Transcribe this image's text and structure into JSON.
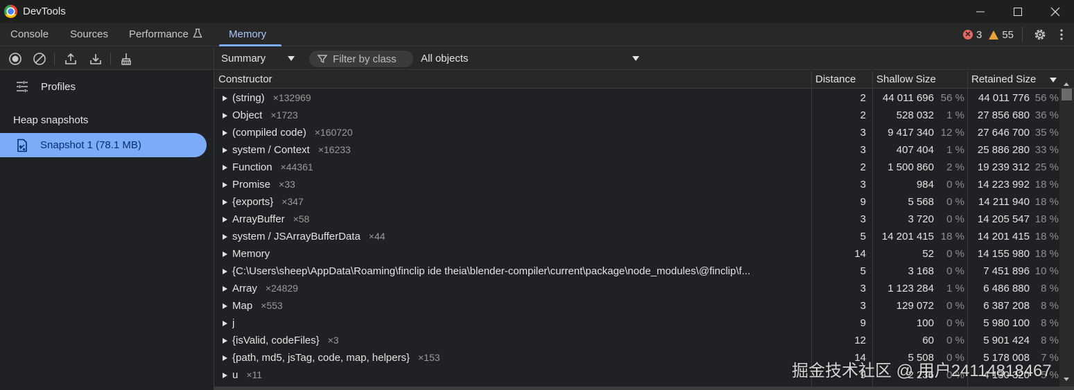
{
  "window": {
    "title": "DevTools",
    "controls": [
      "minimize-icon",
      "maximize-icon",
      "close-icon"
    ]
  },
  "tabs": [
    {
      "label": "Console"
    },
    {
      "label": "Sources"
    },
    {
      "label": "Performance"
    },
    {
      "label": "Memory",
      "active": true
    }
  ],
  "status": {
    "errors": "3",
    "warnings": "55",
    "error_color": "#e46962",
    "warning_color": "#e9a23b"
  },
  "sidebar": {
    "profiles_label": "Profiles",
    "heap_heading": "Heap snapshots",
    "snapshot_label": "Snapshot 1 (78.1 MB)",
    "snapshot_color": "#7cacf8"
  },
  "toolbar": {
    "view_select": "Summary",
    "filter_placeholder": "Filter by class",
    "objects_select": "All objects"
  },
  "table": {
    "columns": [
      "Constructor",
      "Distance",
      "Shallow Size",
      "Retained Size"
    ],
    "rows": [
      {
        "name": "(string)",
        "count": "×132969",
        "distance": "2",
        "shallow": "44 011 696",
        "shallow_pct": "56 %",
        "retained": "44 011 776",
        "retained_pct": "56 %"
      },
      {
        "name": "Object",
        "count": "×1723",
        "distance": "2",
        "shallow": "528 032",
        "shallow_pct": "1 %",
        "retained": "27 856 680",
        "retained_pct": "36 %"
      },
      {
        "name": "(compiled code)",
        "count": "×160720",
        "distance": "3",
        "shallow": "9 417 340",
        "shallow_pct": "12 %",
        "retained": "27 646 700",
        "retained_pct": "35 %"
      },
      {
        "name": "system / Context",
        "count": "×16233",
        "distance": "3",
        "shallow": "407 404",
        "shallow_pct": "1 %",
        "retained": "25 886 280",
        "retained_pct": "33 %"
      },
      {
        "name": "Function",
        "count": "×44361",
        "distance": "2",
        "shallow": "1 500 860",
        "shallow_pct": "2 %",
        "retained": "19 239 312",
        "retained_pct": "25 %"
      },
      {
        "name": "Promise",
        "count": "×33",
        "distance": "3",
        "shallow": "984",
        "shallow_pct": "0 %",
        "retained": "14 223 992",
        "retained_pct": "18 %"
      },
      {
        "name": "{exports}",
        "count": "×347",
        "distance": "9",
        "shallow": "5 568",
        "shallow_pct": "0 %",
        "retained": "14 211 940",
        "retained_pct": "18 %"
      },
      {
        "name": "ArrayBuffer",
        "count": "×58",
        "distance": "3",
        "shallow": "3 720",
        "shallow_pct": "0 %",
        "retained": "14 205 547",
        "retained_pct": "18 %"
      },
      {
        "name": "system / JSArrayBufferData",
        "count": "×44",
        "distance": "5",
        "shallow": "14 201 415",
        "shallow_pct": "18 %",
        "retained": "14 201 415",
        "retained_pct": "18 %"
      },
      {
        "name": "Memory",
        "count": "",
        "distance": "14",
        "shallow": "52",
        "shallow_pct": "0 %",
        "retained": "14 155 980",
        "retained_pct": "18 %"
      },
      {
        "name": "{C:\\Users\\sheep\\AppData\\Roaming\\finclip ide theia\\blender-compiler\\current\\package\\node_modules\\@finclip\\f...",
        "count": "",
        "distance": "5",
        "shallow": "3 168",
        "shallow_pct": "0 %",
        "retained": "7 451 896",
        "retained_pct": "10 %"
      },
      {
        "name": "Array",
        "count": "×24829",
        "distance": "3",
        "shallow": "1 123 284",
        "shallow_pct": "1 %",
        "retained": "6 486 880",
        "retained_pct": "8 %"
      },
      {
        "name": "Map",
        "count": "×553",
        "distance": "3",
        "shallow": "129 072",
        "shallow_pct": "0 %",
        "retained": "6 387 208",
        "retained_pct": "8 %"
      },
      {
        "name": "j",
        "count": "",
        "distance": "9",
        "shallow": "100",
        "shallow_pct": "0 %",
        "retained": "5 980 100",
        "retained_pct": "8 %"
      },
      {
        "name": "{isValid, codeFiles}",
        "count": "×3",
        "distance": "12",
        "shallow": "60",
        "shallow_pct": "0 %",
        "retained": "5 901 424",
        "retained_pct": "8 %"
      },
      {
        "name": "{path, md5, jsTag, code, map, helpers}",
        "count": "×153",
        "distance": "14",
        "shallow": "5 508",
        "shallow_pct": "0 %",
        "retained": "5 178 008",
        "retained_pct": "7 %"
      },
      {
        "name": "u",
        "count": "×11",
        "distance": "9",
        "shallow": "2 236",
        "shallow_pct": "0 %",
        "retained": "4 130 320",
        "retained_pct": "5 %"
      }
    ]
  },
  "watermark": "掘金技术社区 @ 用户24114818467",
  "accent_color": "#7cacf8"
}
